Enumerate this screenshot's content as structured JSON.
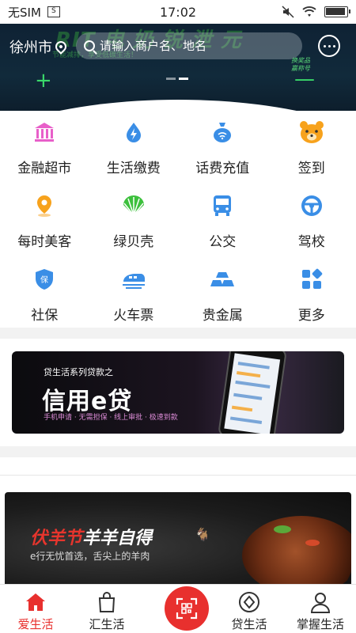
{
  "status_bar": {
    "carrier": "无SIM",
    "time": "17:02"
  },
  "header": {
    "city": "徐州市",
    "search_placeholder": "请输入商户名、地名",
    "banner_title": "RIT 电 奶 锐 泄 元",
    "banner_subtitle": "节能减排，享受低碳生活！",
    "prize_label_line1": "换奖品",
    "prize_label_line2": "赢称号"
  },
  "services": [
    {
      "label": "金融超市",
      "icon": "bank-icon",
      "color": "#e85fc9"
    },
    {
      "label": "生活缴费",
      "icon": "lightning-drop-icon",
      "color": "#3a8ee6"
    },
    {
      "label": "话费充值",
      "icon": "money-bag-icon",
      "color": "#3a8ee6"
    },
    {
      "label": "签到",
      "icon": "bear-icon",
      "color": "#f7a21c"
    },
    {
      "label": "每时美客",
      "icon": "location-pin-icon",
      "color": "#f7a21c"
    },
    {
      "label": "绿贝壳",
      "icon": "shell-icon",
      "color": "#3cc03c"
    },
    {
      "label": "公交",
      "icon": "bus-icon",
      "color": "#3a8ee6"
    },
    {
      "label": "驾校",
      "icon": "steering-wheel-icon",
      "color": "#3a8ee6"
    },
    {
      "label": "社保",
      "icon": "shield-icon",
      "color": "#3a8ee6"
    },
    {
      "label": "火车票",
      "icon": "train-icon",
      "color": "#3a8ee6"
    },
    {
      "label": "贵金属",
      "icon": "gold-bars-icon",
      "color": "#3a8ee6"
    },
    {
      "label": "更多",
      "icon": "more-grid-icon",
      "color": "#3a8ee6"
    }
  ],
  "ad_loan": {
    "small": "贷生活系列贷款之",
    "big": "信用e贷",
    "sub": "手机申请 · 无需担保 · 线上审批 · 极速到款"
  },
  "ad_lamb": {
    "title_red": "伏羊节",
    "title_white": "羊羊自得",
    "slogan": "e行无忧首选，舌尖上的羊肉"
  },
  "tabbar": {
    "tabs": [
      {
        "label": "爱生活"
      },
      {
        "label": "汇生活"
      },
      {
        "label": ""
      },
      {
        "label": "贷生活"
      },
      {
        "label": "掌握生活"
      }
    ]
  },
  "colors": {
    "brand_red": "#e8302e",
    "header_bg": "#112a3b"
  }
}
